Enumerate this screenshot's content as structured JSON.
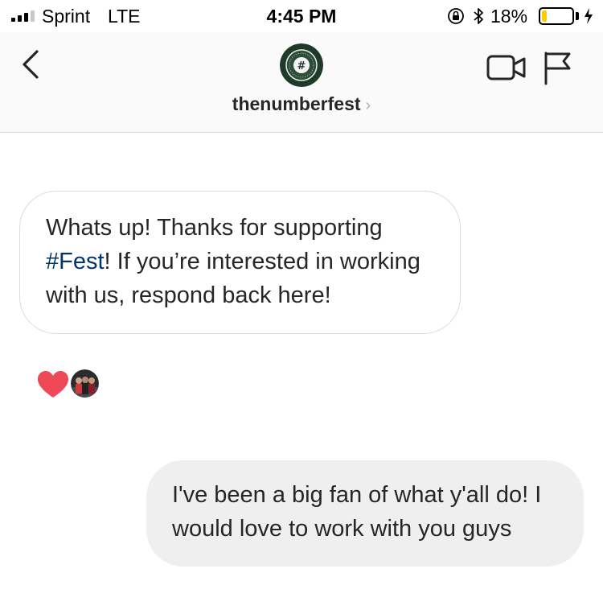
{
  "status_bar": {
    "carrier": "Sprint",
    "network": "LTE",
    "time": "4:45 PM",
    "battery_percent": "18%",
    "battery_level": 0.18,
    "signal_bars_active": 3,
    "signal_bars_total": 4,
    "icons": [
      "signal-icon",
      "orientation-lock-icon",
      "bluetooth-icon",
      "battery-icon",
      "charging-icon"
    ]
  },
  "header": {
    "username": "thenumberfest",
    "chevron": "›",
    "avatar_glyph": "#",
    "icons": [
      "back-icon",
      "video-call-icon",
      "flag-icon"
    ]
  },
  "messages": [
    {
      "direction": "incoming",
      "text_before": "Whats up! Thanks for supporting ",
      "hashtag": "#Fest",
      "text_after": "! If you’re interested in working with us, respond back here!",
      "reactions": [
        "heart-icon",
        "reactor-avatar"
      ]
    },
    {
      "direction": "outgoing",
      "text": "I've been a big fan of what y'all do! I would love to work with you guys"
    }
  ],
  "colors": {
    "hashtag": "#003569",
    "heart": "#ed4956",
    "battery_fill": "#ffcc00",
    "avatar_bg": "#1e3a2b",
    "outgoing_bubble": "#efefef",
    "incoming_border": "#dbdbdb"
  }
}
